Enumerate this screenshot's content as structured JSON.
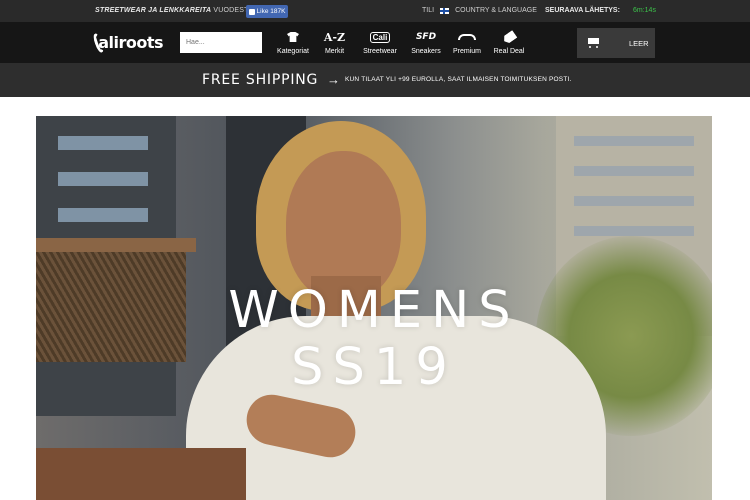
{
  "topbar": {
    "tagline_bold": "STREETWEAR JA LENKKAREITA",
    "tagline_rest": " VUODESTA 2003",
    "fb_label": "Like 187K",
    "lang_code": "TILI",
    "lang_label": "COUNTRY & LANGUAGE",
    "next_ship_label": "SEURAAVA LÄHETYS:",
    "timer": "6m:14s"
  },
  "header": {
    "logo_text": "aliroots",
    "search_placeholder": "Hae...",
    "nav": [
      {
        "label": "Kategoriat",
        "icon": "shirt-icon"
      },
      {
        "label": "Merkit",
        "icon": "a-z-icon",
        "icon_text": "A-Z"
      },
      {
        "label": "Streetwear",
        "icon": "caliroots-icon",
        "icon_text": "Cali"
      },
      {
        "label": "Sneakers",
        "icon": "sfd-icon",
        "icon_text": "SFD"
      },
      {
        "label": "Premium",
        "icon": "premium-icon"
      },
      {
        "label": "Real Deal",
        "icon": "tag-icon"
      }
    ],
    "cart_label": "LEER"
  },
  "shipping": {
    "title": "FREE SHIPPING",
    "arrow": "→",
    "subtitle": "KUN TILAAT YLI +99 EUROLLA, SAAT ILMAISEN TOIMITUKSEN POSTI."
  },
  "hero": {
    "line1": "WOMENS",
    "line2": "SS19"
  },
  "colors": {
    "topbar_bg": "#2a2a2a",
    "header_bg": "#161616",
    "shipbar_bg": "#2e2e2e",
    "timer_green": "#3cc24b",
    "facebook_blue": "#4267b2"
  }
}
